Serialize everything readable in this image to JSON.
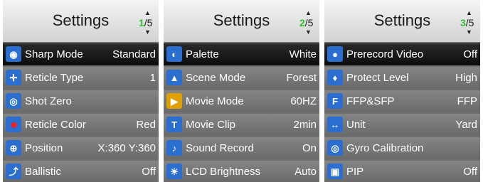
{
  "panels": [
    {
      "title": "Settings",
      "page_current": "1",
      "page_total": "/5",
      "rows": [
        {
          "icon": "eye-icon",
          "glyph": "◉",
          "label": "Sharp Mode",
          "value": "Standard"
        },
        {
          "icon": "reticle-crosshair-icon",
          "glyph": "✛",
          "label": "Reticle Type",
          "value": "1"
        },
        {
          "icon": "target-icon",
          "glyph": "◎",
          "label": "Shot Zero",
          "value": ""
        },
        {
          "icon": "color-dot-icon",
          "glyph": "●",
          "label": "Reticle Color",
          "value": "Red"
        },
        {
          "icon": "position-icon",
          "glyph": "⊕",
          "label": "Position",
          "value": "X:360  Y:360"
        },
        {
          "icon": "ballistic-curve-icon",
          "glyph": "⤴",
          "label": "Ballistic",
          "value": "Off"
        }
      ]
    },
    {
      "title": "Settings",
      "page_current": "2",
      "page_total": "/5",
      "rows": [
        {
          "icon": "palette-icon",
          "glyph": "◐",
          "label": "Palette",
          "value": "White"
        },
        {
          "icon": "scene-forest-icon",
          "glyph": "▲",
          "label": "Scene Mode",
          "value": "Forest"
        },
        {
          "icon": "video-camera-icon",
          "glyph": "▶",
          "label": "Movie Mode",
          "value": "60HZ"
        },
        {
          "icon": "movie-clip-icon",
          "glyph": "T",
          "label": "Movie Clip",
          "value": "2min"
        },
        {
          "icon": "microphone-icon",
          "glyph": "♪",
          "label": "Sound Record",
          "value": "On"
        },
        {
          "icon": "brightness-sun-icon",
          "glyph": "☀",
          "label": "LCD Brightness",
          "value": "Auto"
        }
      ]
    },
    {
      "title": "Settings",
      "page_current": "3",
      "page_total": "/5",
      "rows": [
        {
          "icon": "prerecord-camera-icon",
          "glyph": "●",
          "label": "Prerecord Video",
          "value": "Off"
        },
        {
          "icon": "shield-icon",
          "glyph": "♦",
          "label": "Protect Level",
          "value": "High"
        },
        {
          "icon": "ffp-sfp-icon",
          "glyph": "F",
          "label": "FFP&SFP",
          "value": "FFP"
        },
        {
          "icon": "unit-ruler-icon",
          "glyph": "↔",
          "label": "Unit",
          "value": "Yard"
        },
        {
          "icon": "gyro-icon",
          "glyph": "◎",
          "label": "Gyro Calibration",
          "value": ""
        },
        {
          "icon": "pip-icon",
          "glyph": "▣",
          "label": "PIP",
          "value": "Off"
        }
      ]
    }
  ]
}
